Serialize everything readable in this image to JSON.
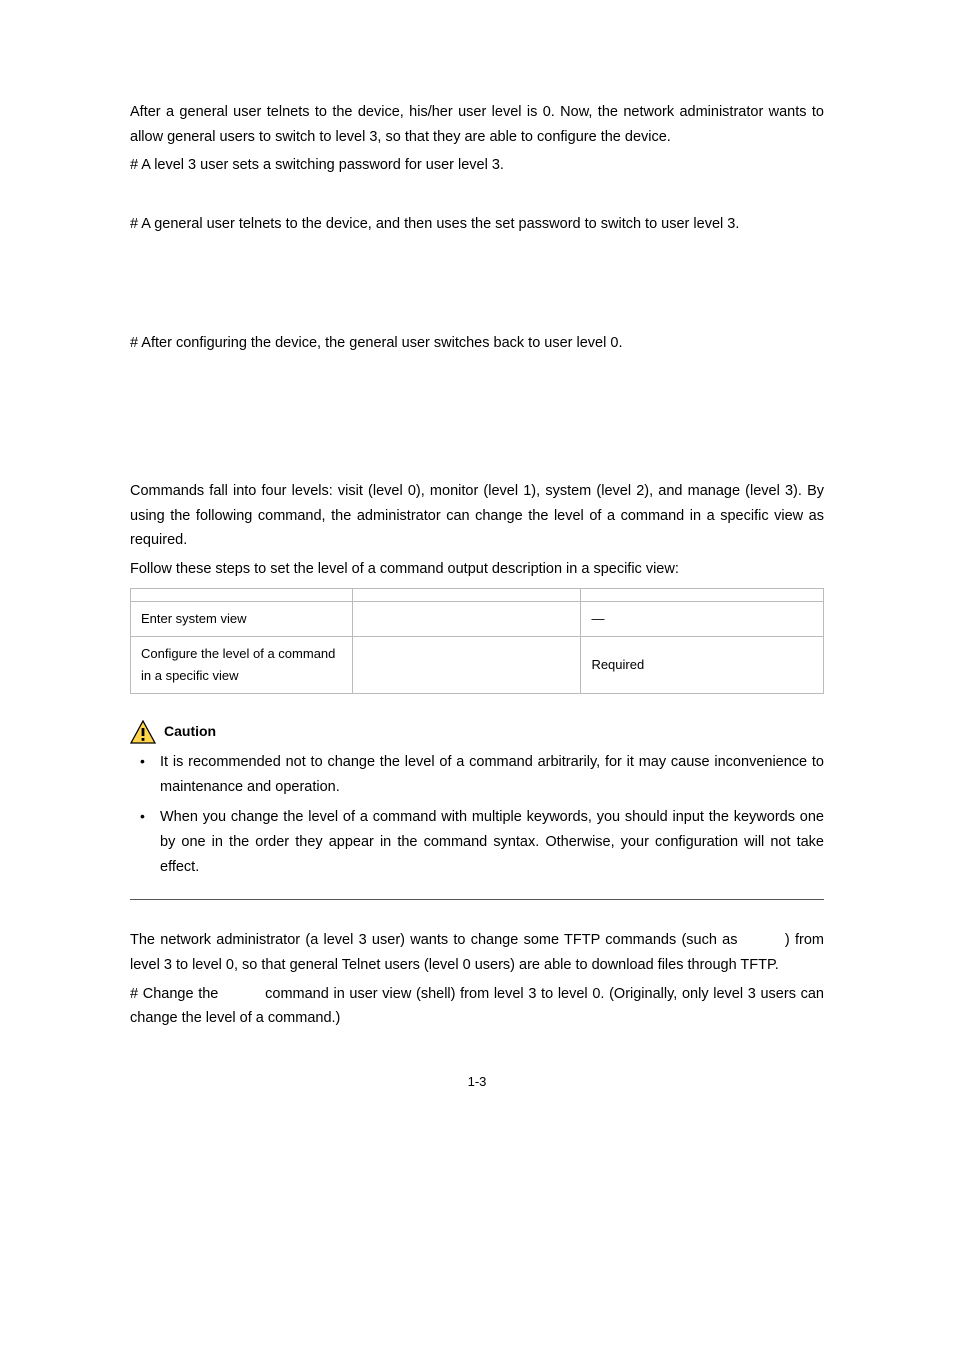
{
  "p1": "After a general user telnets to the device, his/her user level is 0. Now, the network administrator wants to allow general users to switch to level 3, so that they are able to configure the device.",
  "p2": "# A level 3 user sets a switching password for user level 3.",
  "p3": "# A general user telnets to the device, and then uses the set password to switch to user level 3.",
  "p4": "# After configuring the device, the general user switches back to user level 0.",
  "p5": "Commands fall into four levels: visit (level 0), monitor (level 1), system (level 2), and manage (level 3). By using the following command, the administrator can change the level of a command in a specific view as required.",
  "p6": "Follow these steps to set the level of a command output description in a specific view:",
  "table": {
    "headers": [
      "",
      "",
      ""
    ],
    "rows": [
      {
        "c1": "Enter system view",
        "c2": "",
        "c3": "—"
      },
      {
        "c1": "Configure the level of a command in a specific view",
        "c2": "",
        "c3": "Required"
      }
    ]
  },
  "caution_label": "Caution",
  "caution_items": [
    "It is recommended not to change the level of a command arbitrarily, for it may cause inconvenience to maintenance and operation.",
    "When you change the level of a command with multiple keywords, you should input the keywords one by one in the order they appear in the command syntax. Otherwise, your configuration will not take effect."
  ],
  "p7a": "The network administrator (a level 3 user) wants to change some TFTP commands (such as ",
  "p7b": ") from level 3 to level 0, so that general Telnet users (level 0 users) are able to download files through TFTP.",
  "p8a": "# Change the ",
  "p8b": " command in user view (shell) from level 3 to level 0. (Originally, only level 3 users can change the level of a command.)",
  "page_number": "1-3"
}
